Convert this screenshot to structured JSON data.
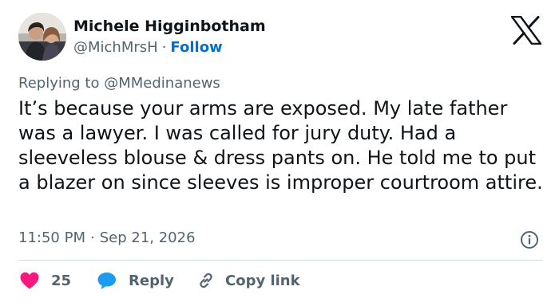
{
  "author": {
    "name": "Michele Higginbotham",
    "handle": "@MichMrsH",
    "separator": "·",
    "follow_label": "Follow"
  },
  "brand_icon": "x-logo-icon",
  "replying": {
    "prefix": "Replying to",
    "mention": "@MMedinanews"
  },
  "tweet": {
    "text": "It’s because your arms are exposed. My late father was a lawyer. I was called for jury duty. Had a sleeveless blouse & dress pants on. He told me to put a blazer on since sleeves is improper courtroom attire.",
    "time": "11:50 PM",
    "separator": "·",
    "date": "Sep 21, 2026"
  },
  "actions": {
    "likes_count": "25",
    "reply_label": "Reply",
    "copy_link_label": "Copy link"
  },
  "colors": {
    "text": "#0f1419",
    "muted": "#536471",
    "follow": "#006fd6",
    "like": "#f91880",
    "reply": "#1d9bf0",
    "divider": "#cfd9de"
  }
}
